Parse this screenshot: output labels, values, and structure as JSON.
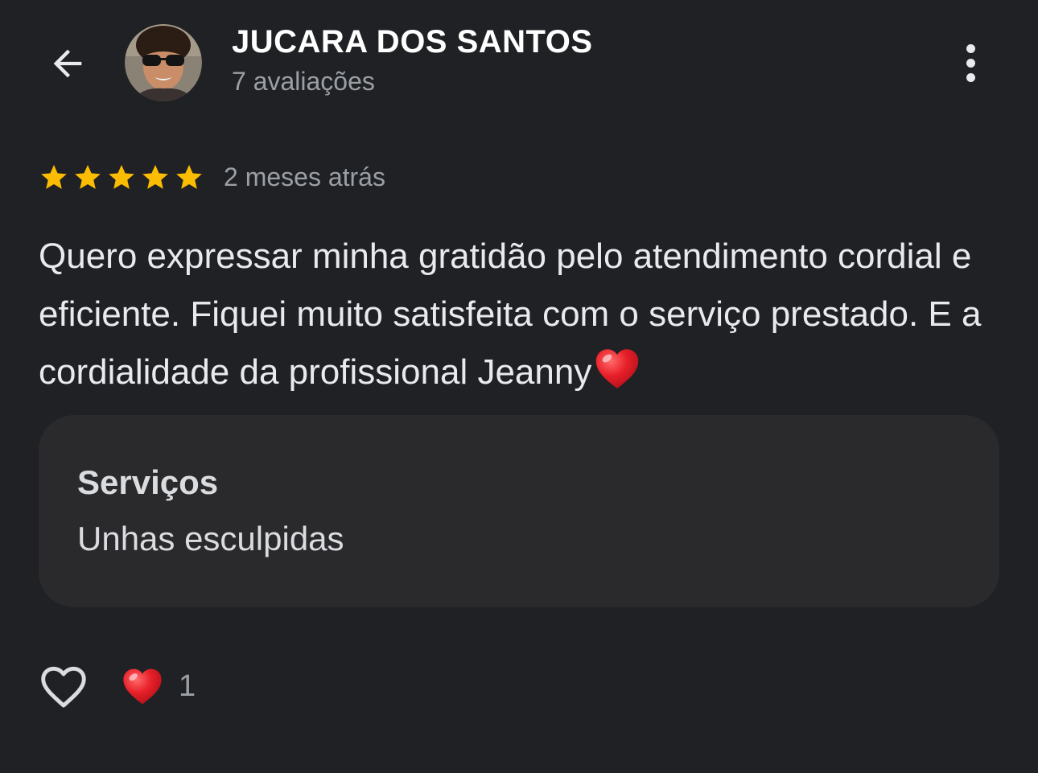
{
  "header": {
    "back_icon": "arrow-left-icon",
    "user_name": "JUCARA DOS SANTOS",
    "review_count": "7 avaliações",
    "more_icon": "more-vertical-icon"
  },
  "review": {
    "rating": 5,
    "max_rating": 5,
    "date": "2 meses atrás",
    "text": "Quero expressar minha gratidão pelo atendimento cordial e eficiente. Fiquei muito satisfeita com o serviço prestado. E a cordialidade da profissional Jeanny",
    "text_emoji": "heart-emoji-icon"
  },
  "services": {
    "title": "Serviços",
    "value": "Unhas esculpidas"
  },
  "actions": {
    "like_icon": "heart-outline-icon",
    "reaction_icon": "heart-emoji-icon",
    "reaction_count": "1"
  },
  "colors": {
    "background": "#202124",
    "card": "#2a2a2d",
    "star": "#fbbc04",
    "heart": "#e0282e",
    "secondary_text": "#9aa0a6"
  }
}
